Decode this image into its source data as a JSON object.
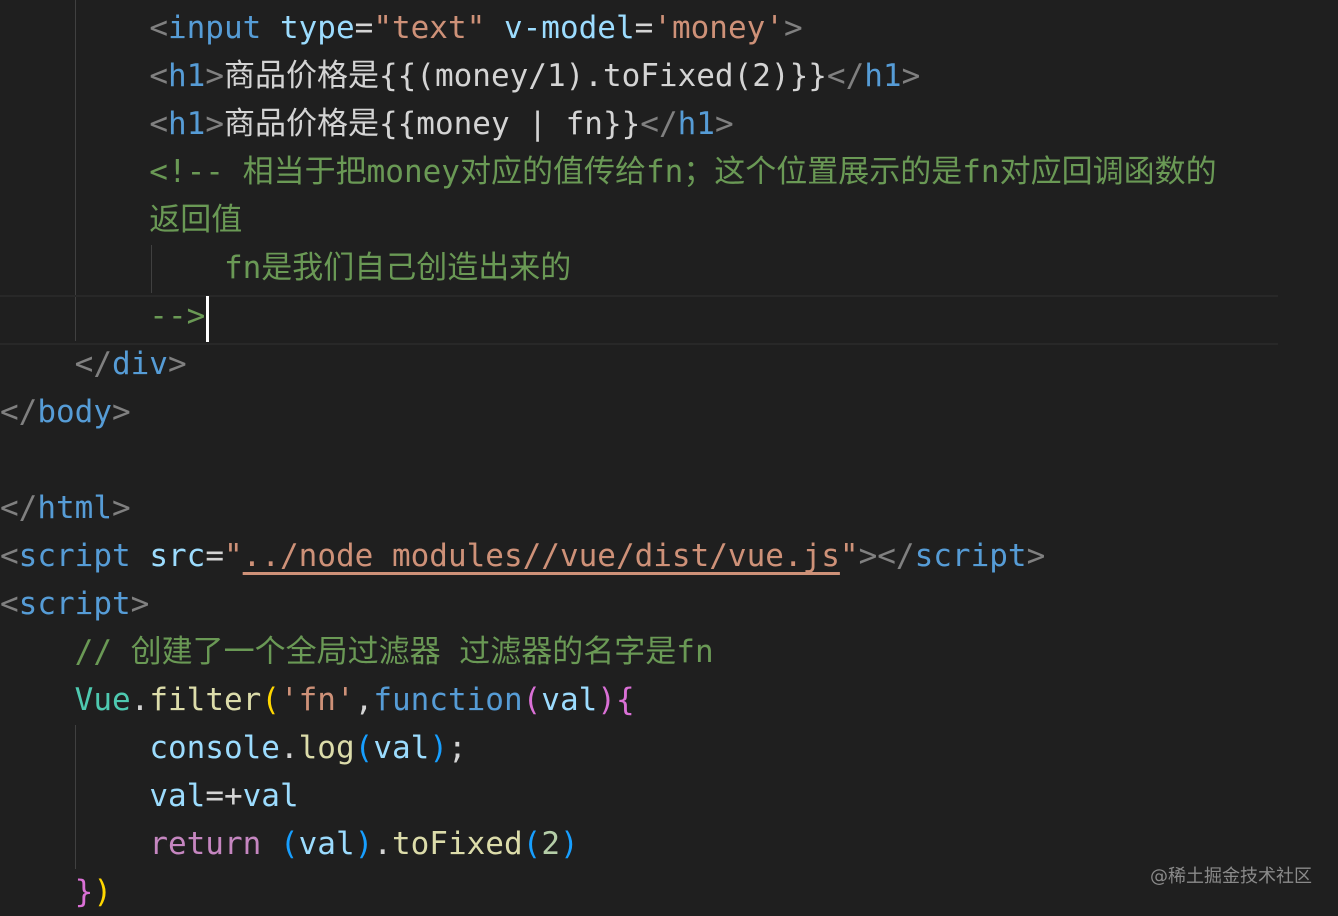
{
  "colors": {
    "background": "#1f1f1f",
    "tag": "#569cd6",
    "attribute": "#9cdcfe",
    "string": "#ce9178",
    "comment": "#6a9955",
    "function": "#dcdcaa",
    "keyword_control": "#c586c0",
    "class": "#4ec9b0"
  },
  "code": {
    "l1": {
      "indent": "        ",
      "tag": "input",
      "attr1": "type",
      "val1": "\"text\"",
      "attr2": "v-model",
      "val2": "'money'"
    },
    "l2": {
      "indent": "        ",
      "tag": "h1",
      "text": "商品价格是{{(money/1).toFixed(2)}}",
      "close": "h1"
    },
    "l3": {
      "indent": "        ",
      "tag": "h1",
      "text": "商品价格是{{money | fn}}",
      "close": "h1"
    },
    "l4": {
      "text": "        <!-- 相当于把money对应的值传给fn；这个位置展示的是fn对应回调函数的"
    },
    "l5": {
      "text": "        返回值"
    },
    "l6": {
      "text": "            fn是我们自己创造出来的"
    },
    "l7": {
      "text": "        -->"
    },
    "l8": {
      "indent": "    ",
      "tag": "div"
    },
    "l9": {
      "tag": "body"
    },
    "l11": {
      "tag": "html"
    },
    "l12": {
      "tag": "script",
      "attr": "src",
      "src": "../node_modules//vue/dist/vue.js"
    },
    "l13": {
      "tag": "script"
    },
    "l14": {
      "text": "    // 创建了一个全局过滤器 过滤器的名字是fn"
    },
    "l15": {
      "obj": "Vue",
      "method": "filter",
      "arg": "'fn'",
      "kw": "function",
      "param": "val"
    },
    "l16": {
      "obj": "console",
      "method": "log",
      "param": "val"
    },
    "l17": {
      "left": "val",
      "op": "=+",
      "right": "val"
    },
    "l18": {
      "kw": "return",
      "param": "val",
      "method": "toFixed",
      "num": "2"
    }
  },
  "watermark": "@稀土掘金技术社区"
}
